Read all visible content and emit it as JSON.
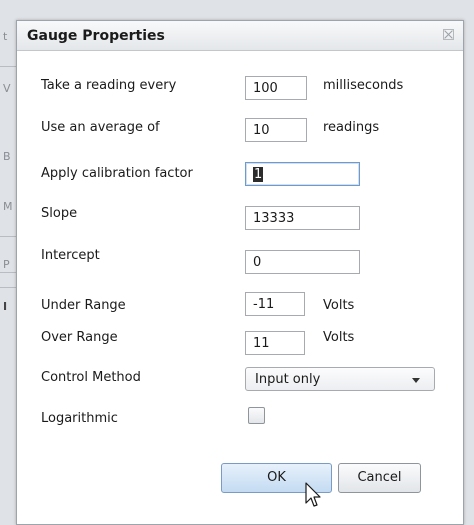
{
  "dialog": {
    "title": "Gauge Properties",
    "rows": {
      "reading_interval": {
        "label": "Take a reading every",
        "value": "100",
        "unit": "milliseconds"
      },
      "average": {
        "label": "Use an average of",
        "value": "10",
        "unit": "readings"
      },
      "calibration": {
        "label": "Apply calibration factor",
        "value": "1"
      },
      "slope": {
        "label": "Slope",
        "value": "13333"
      },
      "intercept": {
        "label": "Intercept",
        "value": "0"
      },
      "under_range": {
        "label": "Under Range",
        "value": "-11",
        "unit": "Volts"
      },
      "over_range": {
        "label": "Over Range",
        "value": "11",
        "unit": "Volts"
      },
      "control_method": {
        "label": "Control Method",
        "value": "Input only"
      },
      "logarithmic": {
        "label": "Logarithmic",
        "checked": false
      }
    },
    "buttons": {
      "ok": "OK",
      "cancel": "Cancel"
    }
  },
  "background": {
    "letters": [
      "t",
      "V",
      "B",
      "M",
      "P",
      "I"
    ]
  },
  "icons": {
    "close": "close-icon",
    "dropdown": "chevron-down-icon",
    "cursor": "mouse-pointer-icon"
  },
  "colors": {
    "dialog_bg": "#ffffff",
    "ok_button": "#c3dbf2",
    "focus_border": "#6f9ac9"
  }
}
